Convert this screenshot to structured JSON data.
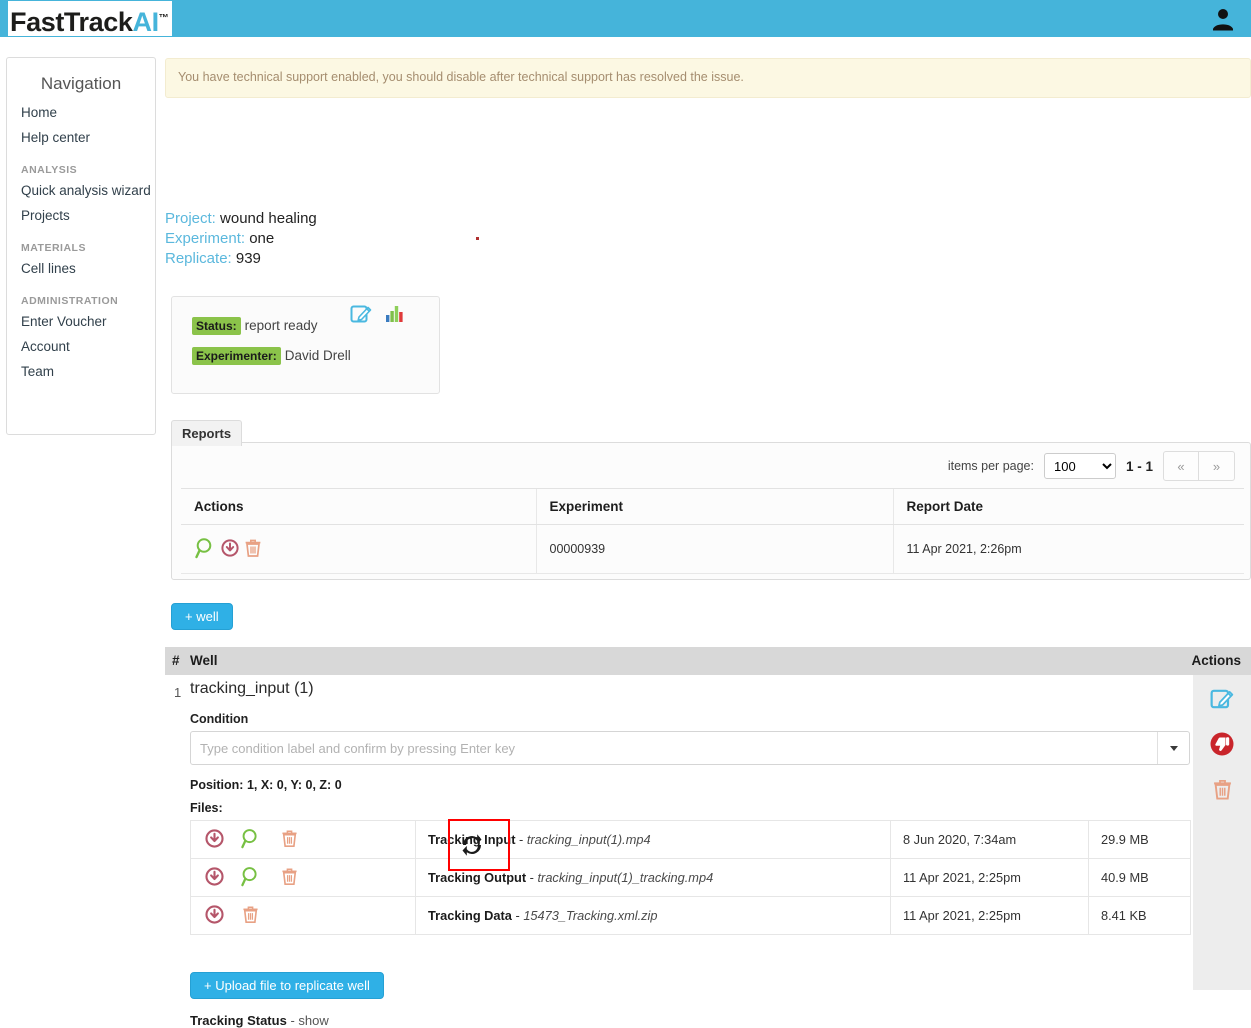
{
  "header": {
    "logo_dark": "FastTrack",
    "logo_ai": "AI",
    "logo_tm": "™",
    "avatar_icon": "user-silhouette-icon"
  },
  "sidebar": {
    "title": "Navigation",
    "items": [
      {
        "label": "Home",
        "type": "link"
      },
      {
        "label": "Help center",
        "type": "link"
      },
      {
        "label": "ANALYSIS",
        "type": "group"
      },
      {
        "label": "Quick analysis wizard",
        "type": "link"
      },
      {
        "label": "Projects",
        "type": "link"
      },
      {
        "label": "MATERIALS",
        "type": "group"
      },
      {
        "label": "Cell lines",
        "type": "link"
      },
      {
        "label": "ADMINISTRATION",
        "type": "group"
      },
      {
        "label": "Enter Voucher",
        "type": "link"
      },
      {
        "label": "Account",
        "type": "link"
      },
      {
        "label": "Team",
        "type": "link"
      }
    ]
  },
  "alert": {
    "message": "You have technical support enabled, you should disable after technical support has resolved the issue."
  },
  "project_info": {
    "project_label": "Project:",
    "project_value": "wound healing",
    "experiment_label": "Experiment:",
    "experiment_value": "one",
    "replicate_label": "Replicate:",
    "replicate_value": "939"
  },
  "status_card": {
    "status_label": "Status:",
    "status_value": "report ready",
    "experimenter_label": "Experimenter:",
    "experimenter_value": "David Drell",
    "edit_icon": "edit-pencil-icon",
    "chart_icon": "bar-chart-icon"
  },
  "reports": {
    "tab_label": "Reports",
    "items_per_page_label": "items per page:",
    "items_per_page_value": "100",
    "items_per_page_options": [
      "100"
    ],
    "range_label": "1 - 1",
    "prev_label": "«",
    "next_label": "»",
    "columns": [
      "Actions",
      "Experiment",
      "Report Date"
    ],
    "rows": [
      {
        "actions": [
          "magnifier-icon",
          "download-circle-icon",
          "trash-icon"
        ],
        "experiment": "00000939",
        "report_date": "11 Apr 2021, 2:26pm"
      }
    ]
  },
  "wells": {
    "add_well_label": "+ well",
    "columns": {
      "num": "#",
      "well": "Well",
      "actions": "Actions"
    },
    "row": {
      "num": "1",
      "name": "tracking_input (1)",
      "condition_label": "Condition",
      "condition_value": "",
      "condition_placeholder": "Type condition label and confirm by pressing Enter key",
      "position_line": "Position: 1, X: 0, Y: 0, Z: 0",
      "files_label": "Files:",
      "upload_label": "+ Upload file to replicate well",
      "tracking_status_label": "Tracking Status",
      "tracking_status_show": "- show",
      "actions": [
        "edit-pencil-icon",
        "thumbs-down-circle-icon",
        "trash-icon"
      ]
    },
    "files": [
      {
        "actions": [
          "download-circle-icon",
          "magnifier-icon",
          "trash-icon",
          "refresh-sync-icon"
        ],
        "type": "Tracking Input",
        "dash": " - ",
        "filename": "tracking_input(1).mp4",
        "date": "8 Jun 2020, 7:34am",
        "size": "29.9 MB"
      },
      {
        "actions": [
          "download-circle-icon",
          "magnifier-icon",
          "trash-icon"
        ],
        "type": "Tracking Output",
        "dash": " - ",
        "filename": "tracking_input(1)_tracking.mp4",
        "date": "11 Apr 2021, 2:25pm",
        "size": "40.9 MB"
      },
      {
        "actions": [
          "download-circle-icon",
          "trash-icon"
        ],
        "type": "Tracking Data",
        "dash": " - ",
        "filename": "15473_Tracking.xml.zip",
        "date": "11 Apr 2021, 2:25pm",
        "size": "8.41 KB"
      }
    ]
  },
  "colors": {
    "header_blue": "#45b4da",
    "link_blue": "#5bb8dd",
    "button_blue": "#2fb0e6",
    "badge_green": "#8bc34a",
    "alert_bg": "#fcf8e3",
    "magnifier_green": "#77c043",
    "download_maroon": "#b5566a",
    "trash_salmon": "#e8a184",
    "highlight_red": "#ff0000"
  }
}
